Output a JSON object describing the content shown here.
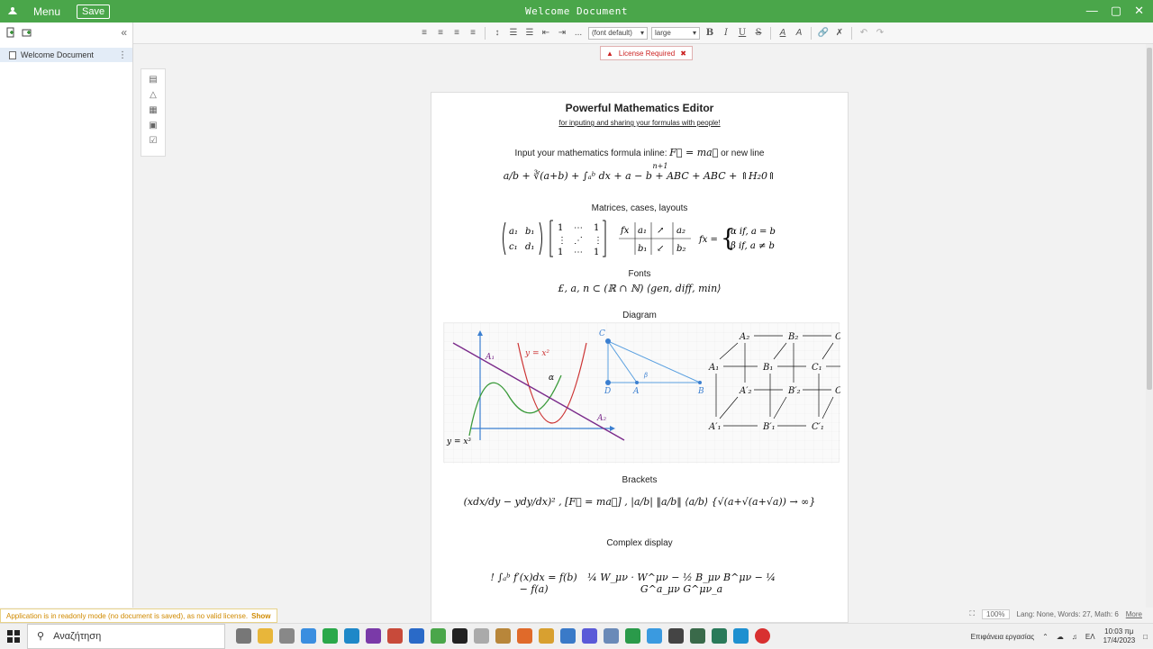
{
  "titlebar": {
    "menu": "Menu",
    "save": "Save",
    "title": "Welcome Document",
    "accent": "#4aa64a"
  },
  "sidebar": {
    "doc_name": "Welcome Document",
    "collapse": "«"
  },
  "toolbar": {
    "font": "(font default)",
    "size": "large",
    "ellipsis": "..."
  },
  "license": {
    "text": "License Required"
  },
  "document": {
    "title": "Powerful Mathematics Editor",
    "subtitle": "for inputing and sharing your formulas with people!",
    "inline_prefix": "Input your mathematics formula inline:",
    "inline_suffix": "or new line",
    "sections": {
      "matrices": "Matrices, cases, layouts",
      "fonts": "Fonts",
      "diagram": "Diagram",
      "brackets": "Brackets",
      "complex": "Complex display"
    },
    "formulas": {
      "inline": "F⃗ = ma⃗",
      "line1": "a/b + ∛(a+b) + ∫ₐᵇ dx + a − b + ABC + ABC + ⇑H₂0⇑",
      "line1_over": "n+1",
      "fonts": "£, a, n ⊂ (ℝ ∩ ℕ) ⟨gen, diff, min⟩",
      "brackets": "(xdx/dy − ydy/dx)² , [F⃗ = ma⃗] , |a/b| ‖a/b‖ ⟨a/b⟩ {√(a+√(a+√a)) → ∞}",
      "complex_left": "!   ∫ₐᵇ f′(x)dx = f(b) − f(a)",
      "complex_right": "¼ W_μν · W^μν − ½ B_μν B^μν − ¼ G^a_μν G^μν_a"
    },
    "diagram_labels": {
      "curve1": "y = x²",
      "curve2": "y = x³",
      "line1": "A₁",
      "line2": "A₂",
      "angle": "α",
      "tri_a": "A",
      "tri_b": "B",
      "tri_c": "C",
      "tri_d": "D",
      "tri_beta": "β"
    }
  },
  "status": {
    "zoom": "100%",
    "info": "Lang: None, Words: 27, Math: 6",
    "more": "More"
  },
  "readonly": {
    "text": "Application is in readonly mode (no document is saved), as no valid license.",
    "show": "Show"
  },
  "taskbar": {
    "search": "Αναζήτηση",
    "desktop": "Επιφάνεια εργασίας",
    "lang": "ΕΛ",
    "time": "10:03 πμ",
    "date": "17/4/2023"
  }
}
